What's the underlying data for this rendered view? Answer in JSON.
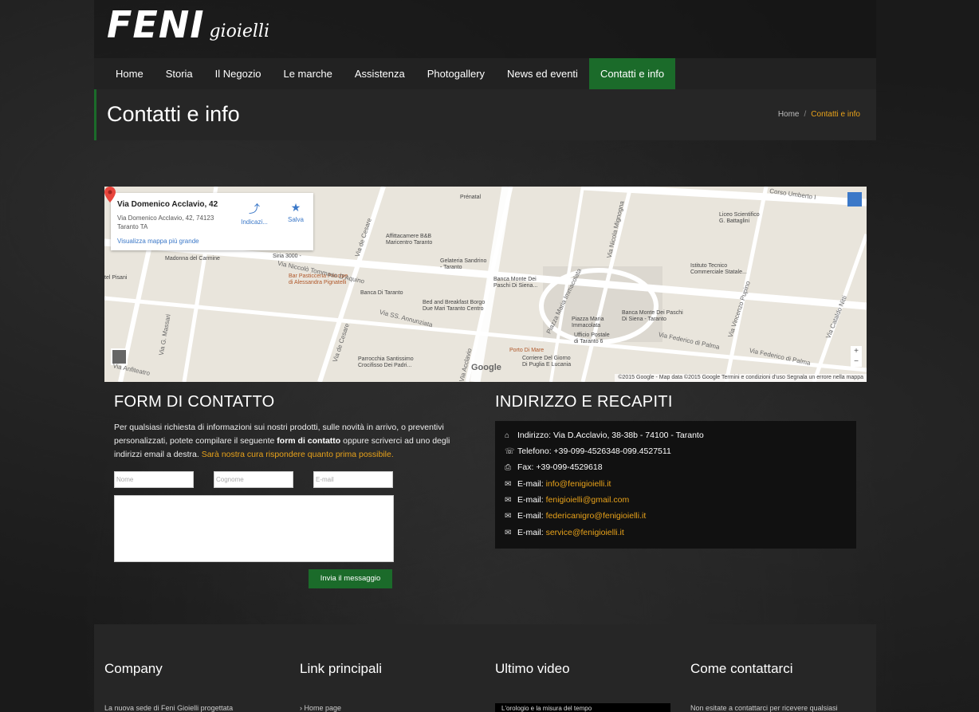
{
  "header": {
    "logo_main": "FENI",
    "logo_sub": "gioielli"
  },
  "nav": {
    "items": [
      {
        "label": "Home"
      },
      {
        "label": "Storia"
      },
      {
        "label": "Il Negozio"
      },
      {
        "label": "Le marche"
      },
      {
        "label": "Assistenza"
      },
      {
        "label": "Photogallery"
      },
      {
        "label": "News ed eventi"
      },
      {
        "label": "Contatti e info",
        "active": true
      }
    ],
    "active_color": "#1b6b2a"
  },
  "page": {
    "title": "Contatti e info",
    "breadcrumb": {
      "home": "Home",
      "separator": "/",
      "current": "Contatti e info"
    }
  },
  "map": {
    "card": {
      "title": "Via Domenico Acclavio, 42",
      "address_line1": "Via Domenico Acclavio, 42, 74123",
      "address_line2": "Taranto TA",
      "link": "Visualizza mappa più grande",
      "action_directions": "Indicazi...",
      "action_save": "Salva"
    },
    "labels": {
      "corso_umberto": "Corso Umberto I",
      "prenatal": "Prénatal",
      "affittacamere": "Affittacamere B&B\nMaricentro Taranto",
      "gelateria": "Gelateria Sandrino\n- Taranto",
      "banca_monte": "Banca Monte Dei\nPaschi Di Siena...",
      "liceo": "Liceo Scientifico\nG. Battaglini",
      "istituto": "Istituto Tecnico\nCommerciale Statale...",
      "madonna": "Madonna del Carmine",
      "sirìa": "Siria 3000 -",
      "pisani": "tel Pisani",
      "pasticceria": "Bar Pasticceria Principe\ndi Alessandra Pignatelli",
      "banca_taranto": "Banca Di Taranto",
      "bnb_borgo": "Bed and Breakfast Borgo\nDue Mari Taranto Centro",
      "piazza": "Piazza Maria\nImmacolata",
      "ufficio": "Ufficio Postale\ndi Taranto 6",
      "banca_monte2": "Banca Monte Dei Paschi\nDi Siena - Taranto",
      "porto": "Porto Di Mare",
      "corriere": "Corriere Del Giorno\nDi Puglia E Lucania",
      "parrocchia": "Parrocchia Santissimo\nCrocifisso Dei Padri...",
      "niccolo": "Via Niccolò Tommaso D'Aquino",
      "annunziata": "Via SS. Annunziata",
      "cesare": "Via de Cesare",
      "cesare2": "Via de Cesare",
      "massari": "Via G. Massari",
      "anfiteatro": "Via Anfiteatro",
      "mignogna": "Via Nicola Mignogna",
      "pupino": "Via Vincenzo Pupino",
      "palma": "Via Federico di Palma",
      "palma2": "Via Federico di Palma",
      "nitti": "Via Cataldo Nitti",
      "immacolata": "Piazza Maria Immacolata",
      "acclavio": "Via Acclavio",
      "google": "Google"
    },
    "footer": "©2015 Google - Map data ©2015 Google     Termini e condizioni d'uso     Segnala un errore nella mappa"
  },
  "form": {
    "title": "FORM DI CONTATTO",
    "intro_1": "Per qualsiasi richiesta di informazioni sui nostri prodotti, sulle novità in arrivo, o preventivi personalizzati, potete compilare il seguente ",
    "intro_bold": "form di contatto",
    "intro_2": " oppure scriverci ad uno degli indirizzi email a destra. ",
    "intro_highlight": "Sarà nostra cura rispondere quanto prima possibile.",
    "name_placeholder": "Nome",
    "surname_placeholder": "Cognome",
    "email_placeholder": "E-mail",
    "submit_label": "Invia il messaggio"
  },
  "contacts": {
    "title": "INDIRIZZO E RECAPITI",
    "address_label": "Indirizzo:",
    "address_value": "Via D.Acclavio, 38-38b - 74100 - Taranto",
    "phone_label": "Telefono:",
    "phone_value": "+39-099-4526348-099.4527511",
    "fax_label": "Fax:",
    "fax_value": "+39-099-4529618",
    "email_label": "E-mail:",
    "emails": [
      "info@fenigioielli.it",
      "fenigioielli@gmail.com",
      "federicanigro@fenigioielli.it",
      "service@fenigioielli.it"
    ],
    "link_color": "#e8a21a"
  },
  "footer": {
    "col1_title": "Company",
    "col1_text": "La nuova sede di Feni Gioielli progettata",
    "col2_title": "Link principali",
    "col2_item": "Home page",
    "col3_title": "Ultimo video",
    "col3_video": "L'orologio e la misura del tempo",
    "col4_title": "Come contattarci",
    "col4_text": "Non esitate a contattarci per ricevere qualsiasi"
  }
}
